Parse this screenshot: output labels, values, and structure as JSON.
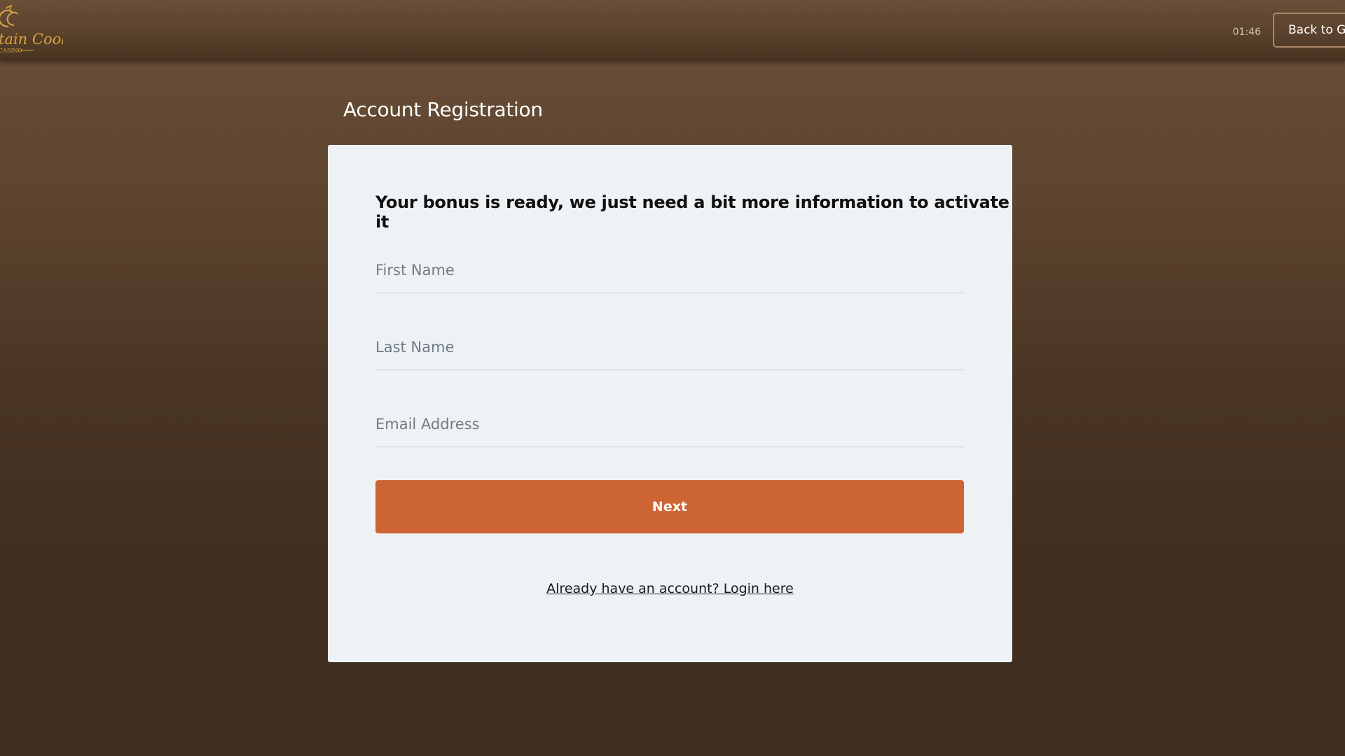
{
  "header": {
    "logo_text": "tain Cooks",
    "logo_subtext": "CASINO",
    "clock": "01:46",
    "back_button_label": "Back to Games"
  },
  "page": {
    "title": "Account Registration"
  },
  "form": {
    "headline": "Your bonus is ready, we just need a bit more information to activate it",
    "first_name_placeholder": "First Name",
    "last_name_placeholder": "Last Name",
    "email_placeholder": "Email Address",
    "first_name_value": "",
    "last_name_value": "",
    "email_value": "",
    "next_button_label": "Next",
    "login_link_label": "Already have an account? Login here"
  },
  "colors": {
    "accent_button": "#cd6434",
    "logo_gold": "#d9a441",
    "card_background": "#eff2f5"
  }
}
